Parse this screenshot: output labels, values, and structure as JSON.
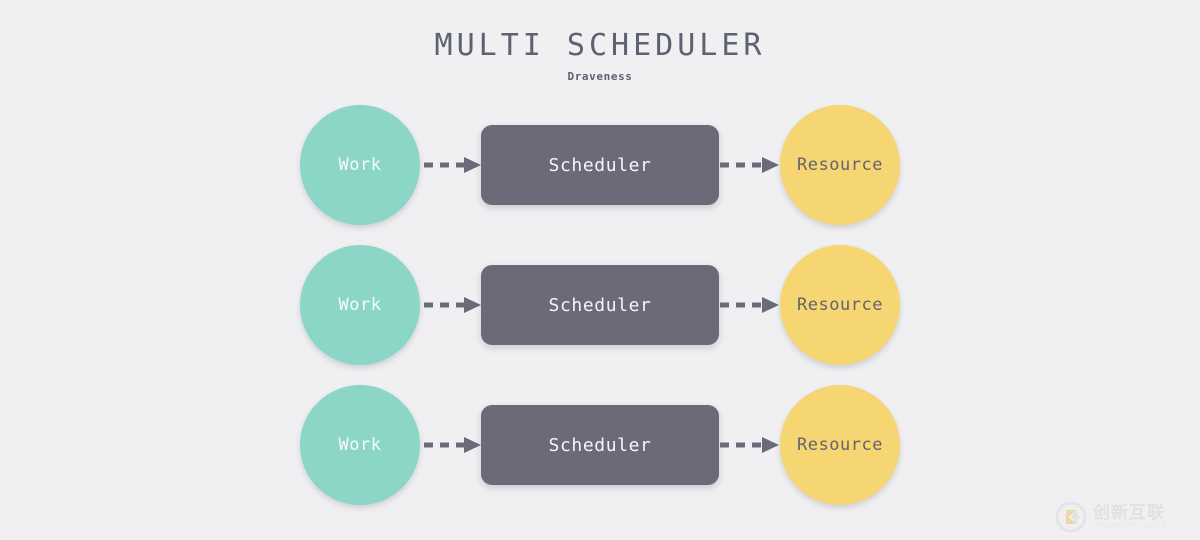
{
  "header": {
    "title": "MULTI SCHEDULER",
    "subtitle": "Draveness"
  },
  "colors": {
    "background": "#f0f0f2",
    "work_fill": "#8cd6c8",
    "work_text": "#f4fbfa",
    "scheduler_fill": "#6a6a78",
    "scheduler_text": "#f5f5f7",
    "resource_fill": "#f5d673",
    "resource_text": "#63636f",
    "arrow": "#6a6a78",
    "title_text": "#5c6270"
  },
  "diagram": {
    "type": "flow",
    "rows": [
      {
        "work_label": "Work",
        "scheduler_label": "Scheduler",
        "resource_label": "Resource",
        "arrow_1_style": "dashed-arrow-right",
        "arrow_2_style": "dashed-arrow-right"
      },
      {
        "work_label": "Work",
        "scheduler_label": "Scheduler",
        "resource_label": "Resource",
        "arrow_1_style": "dashed-arrow-right",
        "arrow_2_style": "dashed-arrow-right"
      },
      {
        "work_label": "Work",
        "scheduler_label": "Scheduler",
        "resource_label": "Resource",
        "arrow_1_style": "dashed-arrow-right",
        "arrow_2_style": "dashed-arrow-right"
      }
    ]
  },
  "watermark": {
    "name": "创新互联",
    "tagline": "CHUANGXIN HULIAN"
  }
}
